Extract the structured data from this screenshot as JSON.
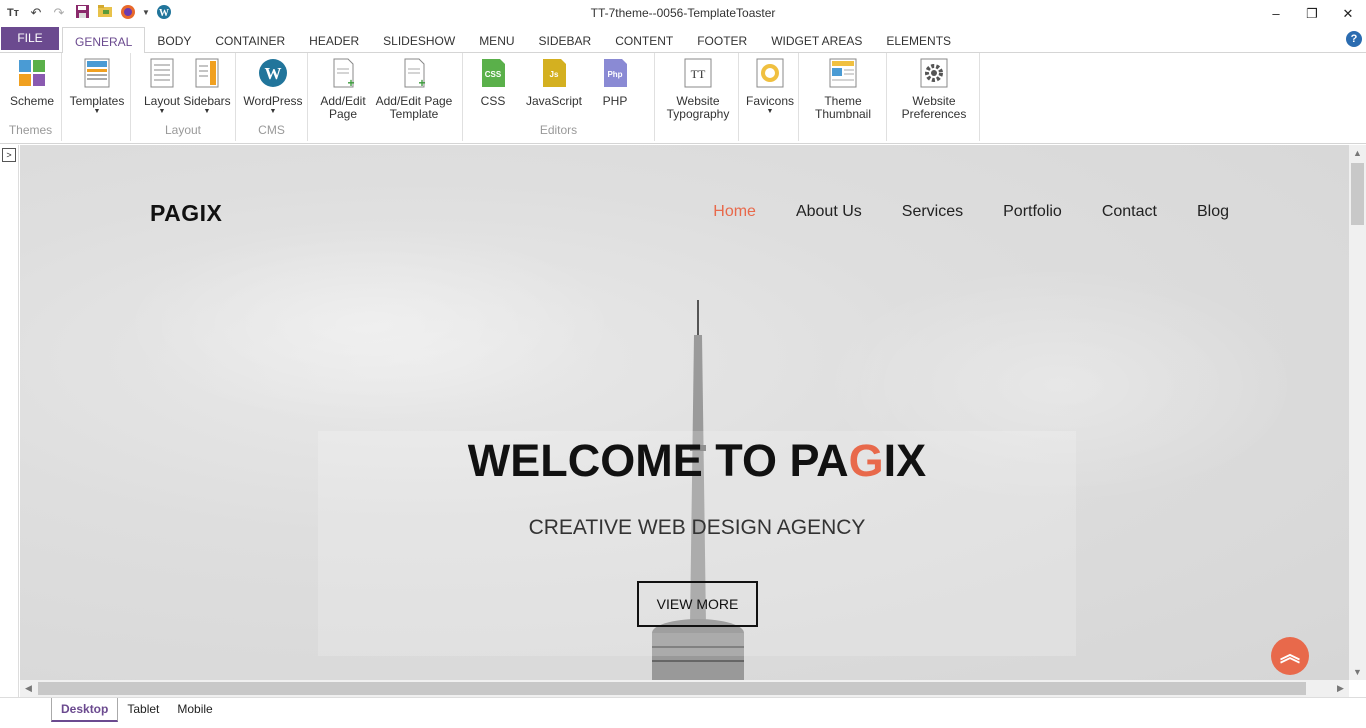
{
  "window": {
    "title": "TT-7theme--0056-TemplateToaster",
    "controls": [
      "minimize",
      "restore",
      "close"
    ]
  },
  "quick_access": [
    "tt-logo-icon",
    "undo-icon",
    "redo-icon",
    "save-icon",
    "open-folder-icon",
    "firefox-icon",
    "dropdown-icon",
    "wordpress-icon"
  ],
  "ribbon": {
    "file_label": "FILE",
    "tabs": [
      "GENERAL",
      "BODY",
      "CONTAINER",
      "HEADER",
      "SLIDESHOW",
      "MENU",
      "SIDEBAR",
      "CONTENT",
      "FOOTER",
      "WIDGET AREAS",
      "ELEMENTS"
    ],
    "active_tab": "GENERAL",
    "help": "?",
    "groups": {
      "themes": {
        "label": "Themes",
        "scheme": "Scheme"
      },
      "templates": {
        "label": "Templates"
      },
      "layout": {
        "label": "Layout",
        "layout": "Layout",
        "sidebars": "Sidebars"
      },
      "cms": {
        "label": "CMS",
        "wordpress": "WordPress"
      },
      "pages": {
        "add_edit_page_1": "Add/Edit",
        "add_edit_page_2": "Page",
        "add_edit_tpl_1": "Add/Edit Page",
        "add_edit_tpl_2": "Template"
      },
      "editors": {
        "label": "Editors",
        "css": "CSS",
        "javascript": "JavaScript",
        "php": "PHP",
        "css_badge": "CSS",
        "js_badge": "Js",
        "php_badge": "Php"
      },
      "typography": {
        "line1": "Website",
        "line2": "Typography"
      },
      "favicons": {
        "label": "Favicons"
      },
      "thumbnail": {
        "line1": "Theme",
        "line2": "Thumbnail"
      },
      "preferences": {
        "line1": "Website",
        "line2": "Preferences"
      }
    }
  },
  "preview": {
    "logo": "PAGIX",
    "nav": [
      "Home",
      "About Us",
      "Services",
      "Portfolio",
      "Contact",
      "Blog"
    ],
    "active_nav": "Home",
    "hero_title_pre": "WELCOME TO PA",
    "hero_title_accent": "G",
    "hero_title_post": "IX",
    "hero_subtitle": "CREATIVE WEB DESIGN AGENCY",
    "cta": "VIEW MORE",
    "accent_color": "#e8694b"
  },
  "device_tabs": [
    "Desktop",
    "Tablet",
    "Mobile"
  ],
  "active_device": "Desktop"
}
